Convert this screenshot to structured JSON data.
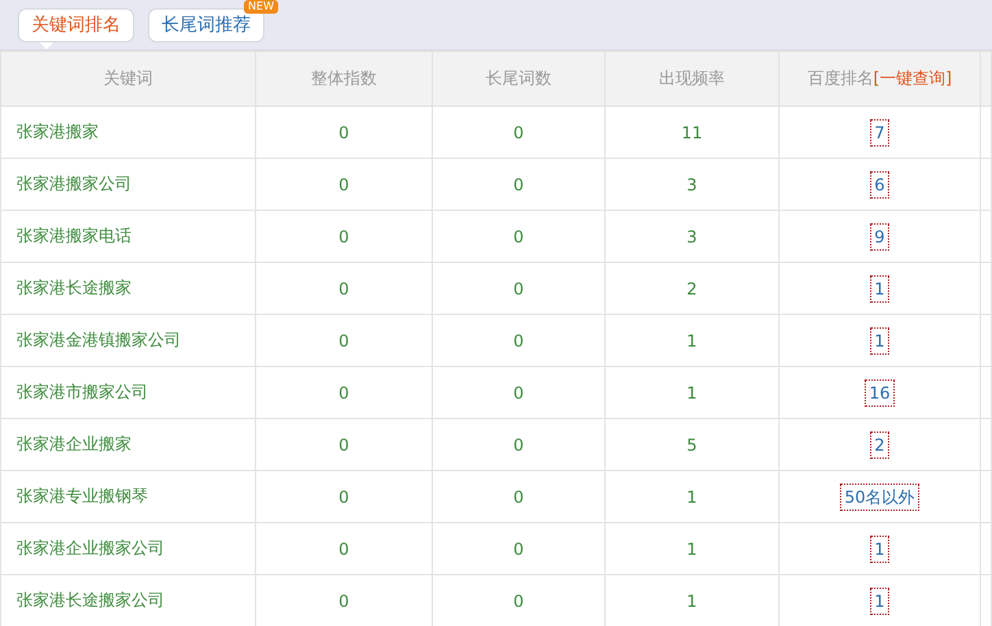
{
  "tabs": [
    {
      "label": "关键词排名",
      "selected": true
    },
    {
      "label": "长尾词推荐",
      "selected": false,
      "badge": "NEW"
    }
  ],
  "table": {
    "columns": [
      "关键词",
      "整体指数",
      "长尾词数",
      "出现频率",
      "百度排名"
    ],
    "query_link": "[一键查询]",
    "rows": [
      {
        "keyword": "张家港搬家",
        "index": "0",
        "longtail": "0",
        "frequency": "11",
        "rank": "7"
      },
      {
        "keyword": "张家港搬家公司",
        "index": "0",
        "longtail": "0",
        "frequency": "3",
        "rank": "6"
      },
      {
        "keyword": "张家港搬家电话",
        "index": "0",
        "longtail": "0",
        "frequency": "3",
        "rank": "9"
      },
      {
        "keyword": "张家港长途搬家",
        "index": "0",
        "longtail": "0",
        "frequency": "2",
        "rank": "1"
      },
      {
        "keyword": "张家港金港镇搬家公司",
        "index": "0",
        "longtail": "0",
        "frequency": "1",
        "rank": "1"
      },
      {
        "keyword": "张家港市搬家公司",
        "index": "0",
        "longtail": "0",
        "frequency": "1",
        "rank": "16"
      },
      {
        "keyword": "张家港企业搬家",
        "index": "0",
        "longtail": "0",
        "frequency": "5",
        "rank": "2"
      },
      {
        "keyword": "张家港专业搬钢琴",
        "index": "0",
        "longtail": "0",
        "frequency": "1",
        "rank": "50名以外"
      },
      {
        "keyword": "张家港企业搬家公司",
        "index": "0",
        "longtail": "0",
        "frequency": "1",
        "rank": "1"
      },
      {
        "keyword": "张家港长途搬家公司",
        "index": "0",
        "longtail": "0",
        "frequency": "1",
        "rank": "1"
      }
    ]
  }
}
